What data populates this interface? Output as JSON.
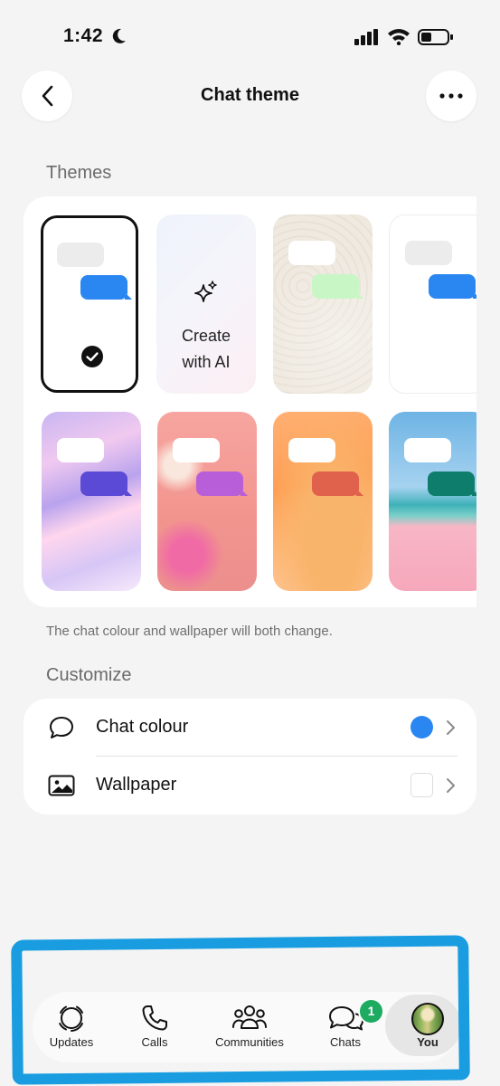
{
  "status_bar": {
    "time": "1:42"
  },
  "header": {
    "title": "Chat theme"
  },
  "themes": {
    "label": "Themes",
    "create_ai_label_line1": "Create",
    "create_ai_label_line2": "with AI",
    "caption": "The chat colour and wallpaper will both change."
  },
  "customize": {
    "label": "Customize",
    "chat_colour_label": "Chat colour",
    "chat_colour_value": "#2a86f0",
    "wallpaper_label": "Wallpaper"
  },
  "nav": {
    "updates": "Updates",
    "calls": "Calls",
    "communities": "Communities",
    "chats": "Chats",
    "chats_badge": "1",
    "you": "You"
  },
  "colors": {
    "accent_blue": "#2a86f0",
    "badge_green": "#1daa61",
    "annotation_blue": "#1a9de0"
  }
}
